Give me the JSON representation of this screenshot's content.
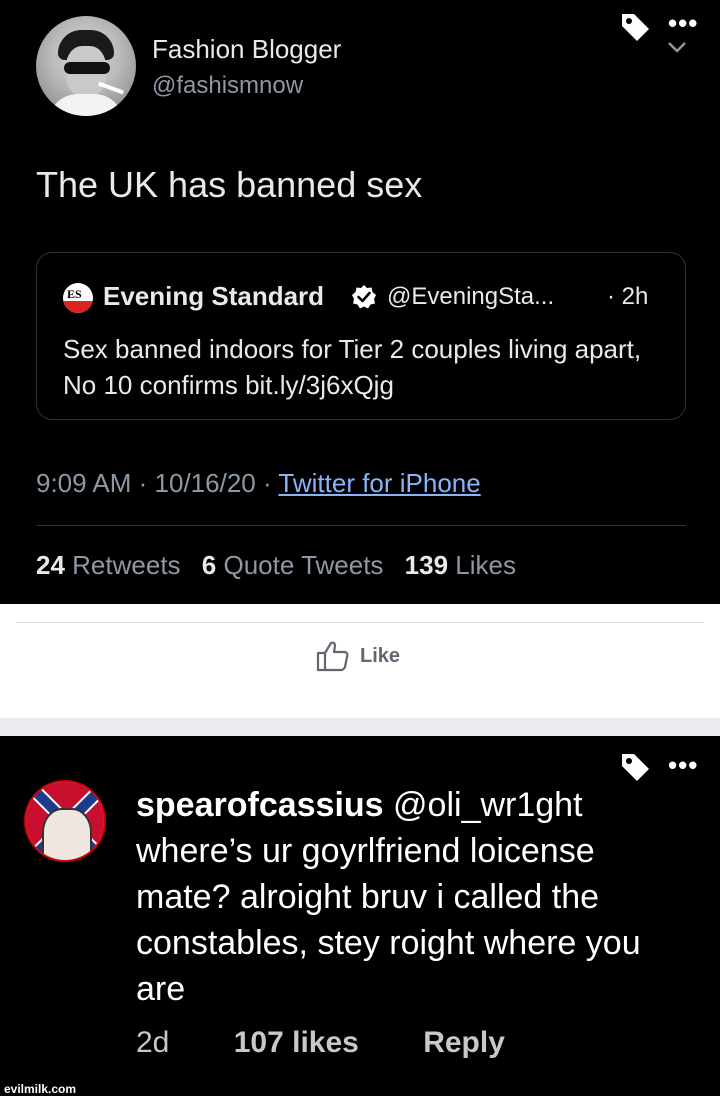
{
  "tweet": {
    "display_name": "Fashion Blogger",
    "handle": "@fashismnow",
    "text": "The UK has banned sex",
    "quoted": {
      "logo_text": "ES",
      "name": "Evening Standard",
      "handle": "@EveningSta...",
      "time": "· 2h",
      "text": "Sex banned indoors for Tier 2 couples living apart, No 10 confirms bit.ly/3j6xQjg"
    },
    "time": "9:09 AM",
    "date": "10/16/20",
    "source": "Twitter for iPhone",
    "stats": {
      "retweets_count": "24",
      "retweets_label": "Retweets",
      "quotes_count": "6",
      "quotes_label": "Quote Tweets",
      "likes_count": "139",
      "likes_label": "Likes"
    },
    "more_glyph": "•••"
  },
  "facebook": {
    "like_label": "Like"
  },
  "comment": {
    "username": "spearofcassius",
    "mention": "@oli_wr1ght",
    "text": "where’s ur goyrlfriend loicense mate? alroight bruv i called the constables, stey roight where you are",
    "age": "2d",
    "likes": "107 likes",
    "reply_label": "Reply",
    "more_glyph": "•••"
  },
  "watermark": "evilmilk.com",
  "colors": {
    "background": "#000000",
    "link": "#8ab4f8",
    "muted": "#8b98a5",
    "verified_badge": "#ffffff",
    "es_red": "#d9231f"
  },
  "icons": [
    "tag-icon",
    "more-icon",
    "chevron-down-icon",
    "verified-icon",
    "thumbs-up-icon"
  ]
}
